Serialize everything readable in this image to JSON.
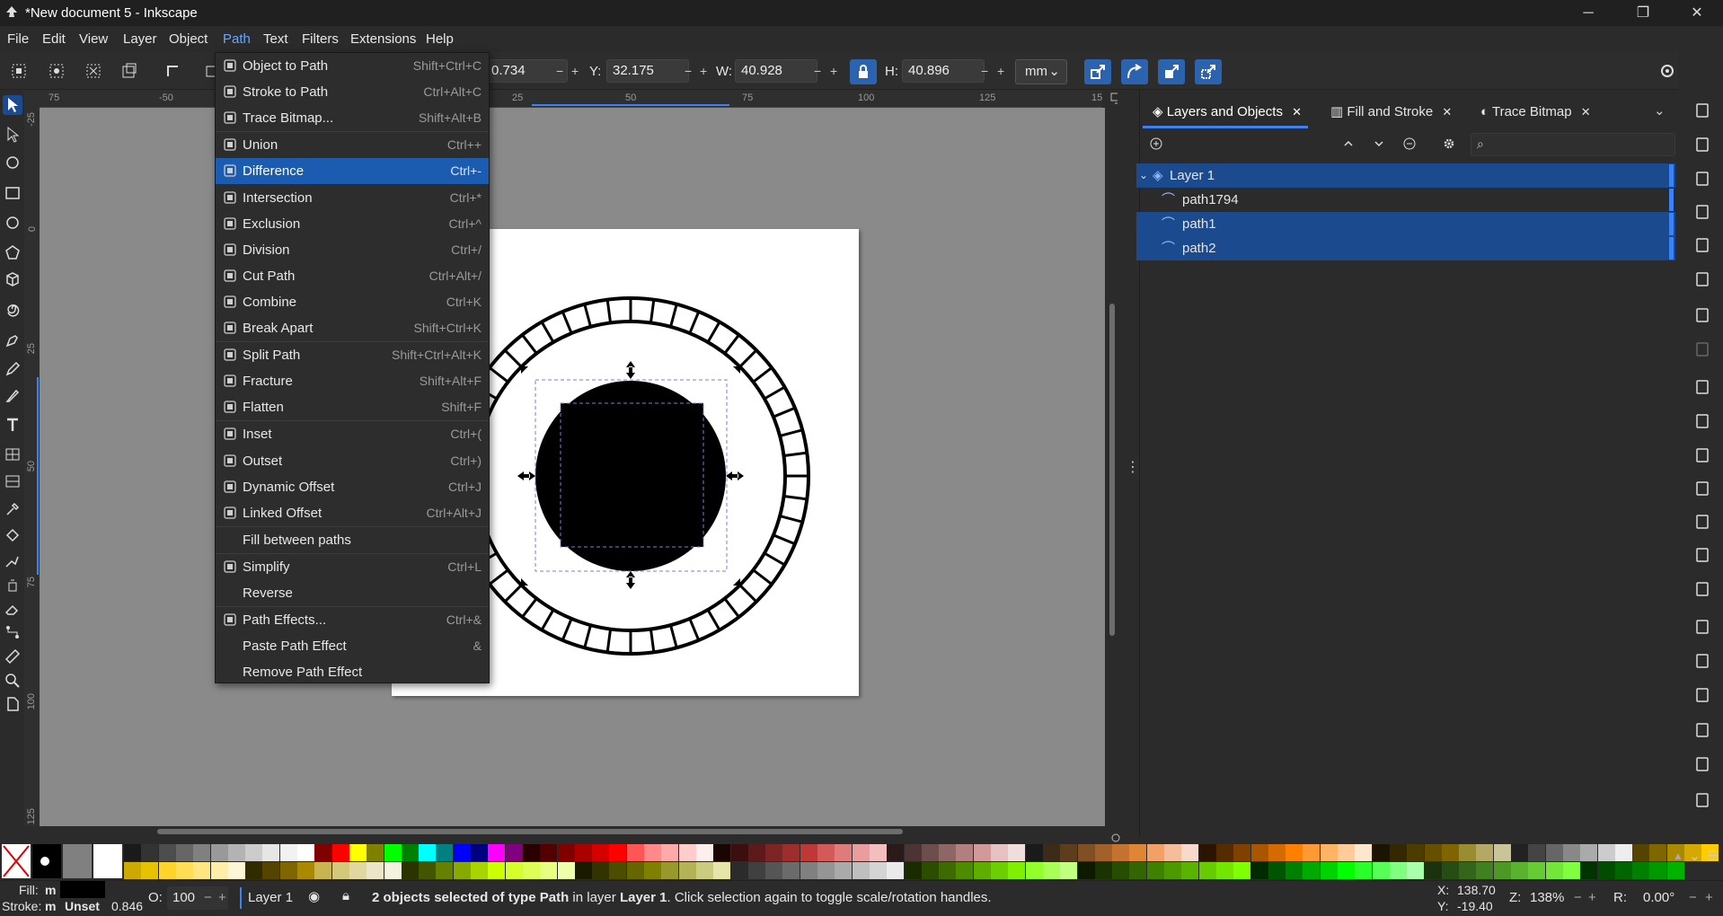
{
  "window": {
    "title": "*New document 5 - Inkscape",
    "minimize": "─",
    "maximize": "❐",
    "close": "✕"
  },
  "menubar": [
    "File",
    "Edit",
    "View",
    "Layer",
    "Object",
    "Path",
    "Text",
    "Filters",
    "Extensions",
    "Help"
  ],
  "toolbar": {
    "x_value": "0.734",
    "y_label": "Y:",
    "y_value": "32.175",
    "w_label": "W:",
    "w_value": "40.928",
    "h_label": "H:",
    "h_value": "40.896",
    "units": "mm",
    "spin_minus": "−",
    "spin_plus": "+"
  },
  "rulers": {
    "h": [
      "75",
      "-50",
      "25",
      "50",
      "75",
      "100",
      "125",
      "15"
    ],
    "v": [
      "-25",
      "0",
      "25",
      "50",
      "75",
      "100",
      "125"
    ]
  },
  "path_menu": [
    {
      "label": "Object to Path",
      "shortcut": "Shift+Ctrl+C",
      "icon": "object-to-path-icon"
    },
    {
      "label": "Stroke to Path",
      "shortcut": "Ctrl+Alt+C",
      "icon": "stroke-to-path-icon"
    },
    {
      "label": "Trace Bitmap...",
      "shortcut": "Shift+Alt+B",
      "icon": "trace-bitmap-icon"
    },
    {
      "label": "Union",
      "shortcut": "Ctrl++",
      "icon": "union-icon"
    },
    {
      "label": "Difference",
      "shortcut": "Ctrl+-",
      "icon": "difference-icon",
      "highlighted": true
    },
    {
      "label": "Intersection",
      "shortcut": "Ctrl+*",
      "icon": "intersection-icon"
    },
    {
      "label": "Exclusion",
      "shortcut": "Ctrl+^",
      "icon": "exclusion-icon"
    },
    {
      "label": "Division",
      "shortcut": "Ctrl+/",
      "icon": "division-icon"
    },
    {
      "label": "Cut Path",
      "shortcut": "Ctrl+Alt+/",
      "icon": "cut-path-icon"
    },
    {
      "label": "Combine",
      "shortcut": "Ctrl+K",
      "icon": "combine-icon"
    },
    {
      "label": "Break Apart",
      "shortcut": "Shift+Ctrl+K",
      "icon": "break-apart-icon"
    },
    {
      "label": "Split Path",
      "shortcut": "Shift+Ctrl+Alt+K",
      "icon": "split-path-icon"
    },
    {
      "label": "Fracture",
      "shortcut": "Shift+Alt+F",
      "icon": "fracture-icon"
    },
    {
      "label": "Flatten",
      "shortcut": "Shift+F",
      "icon": "flatten-icon"
    },
    {
      "label": "Inset",
      "shortcut": "Ctrl+(",
      "icon": "inset-icon"
    },
    {
      "label": "Outset",
      "shortcut": "Ctrl+)",
      "icon": "outset-icon"
    },
    {
      "label": "Dynamic Offset",
      "shortcut": "Ctrl+J",
      "icon": "dynamic-offset-icon"
    },
    {
      "label": "Linked Offset",
      "shortcut": "Ctrl+Alt+J",
      "icon": "linked-offset-icon"
    },
    {
      "label": "Fill between paths",
      "shortcut": "",
      "icon": ""
    },
    {
      "label": "Simplify",
      "shortcut": "Ctrl+L",
      "icon": "simplify-icon"
    },
    {
      "label": "Reverse",
      "shortcut": "",
      "icon": ""
    },
    {
      "label": "Path Effects...",
      "shortcut": "Ctrl+&",
      "icon": "path-effects-icon"
    },
    {
      "label": "Paste Path Effect",
      "shortcut": "&",
      "icon": ""
    },
    {
      "label": "Remove Path Effect",
      "shortcut": "",
      "icon": ""
    }
  ],
  "panel": {
    "tabs": [
      {
        "label": "Layers and Objects"
      },
      {
        "label": "Fill and Stroke"
      },
      {
        "label": "Trace Bitmap"
      }
    ],
    "tab_close": "✕",
    "tree": [
      {
        "label": "Layer 1",
        "type": "layer"
      },
      {
        "label": "path1794",
        "type": "path"
      },
      {
        "label": "path1",
        "type": "path"
      },
      {
        "label": "path2",
        "type": "path"
      }
    ]
  },
  "status": {
    "fill_label": "Fill:",
    "fill_value": "m",
    "stroke_label": "Stroke:",
    "stroke_value": "m",
    "stroke_unset": "Unset",
    "stroke_width": "0.846",
    "opacity_label": "O:",
    "opacity_value": "100",
    "layer": "Layer 1",
    "msg_count": "2 objects selected of type ",
    "msg_type": "Path",
    "msg_mid": " in layer ",
    "msg_layer": "Layer 1",
    "msg_end": ". Click selection again to toggle scale/rotation handles.",
    "x_label": "X:",
    "x_value": "138.70",
    "y_label": "Y:",
    "y_value": "-19.40",
    "zoom_label": "Z:",
    "zoom_value": "138%",
    "rot_label": "R:",
    "rot_value": "0.00°"
  },
  "colors": {
    "accent": "#1c5cb0",
    "selection": "#1c4a8f",
    "tab_underline": "#3b82f6"
  }
}
